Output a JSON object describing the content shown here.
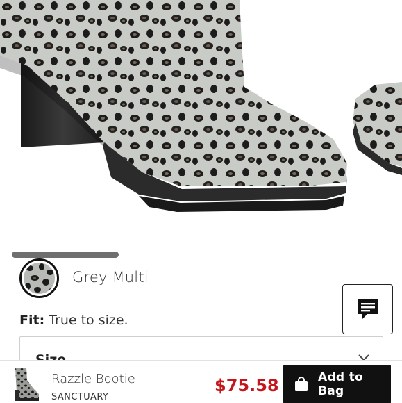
{
  "product_image": {
    "icon": "leopard-print-bootie-photo"
  },
  "carousel": {
    "progress_fraction": 1.0
  },
  "color": {
    "name": "Grey Multi",
    "swatch_icon": "leopard-swatch-icon"
  },
  "chat": {
    "icon": "chat-bubble-icon"
  },
  "fit": {
    "label": "Fit:",
    "value": "True to size."
  },
  "size": {
    "label": "Size"
  },
  "bottom_bar": {
    "product_name": "Razzle Bootie",
    "brand": "SANCTUARY",
    "price": "$75.58",
    "add_button_label": "Add to Bag",
    "bag_icon": "shopping-bag-icon",
    "price_color": "#c4161c"
  }
}
